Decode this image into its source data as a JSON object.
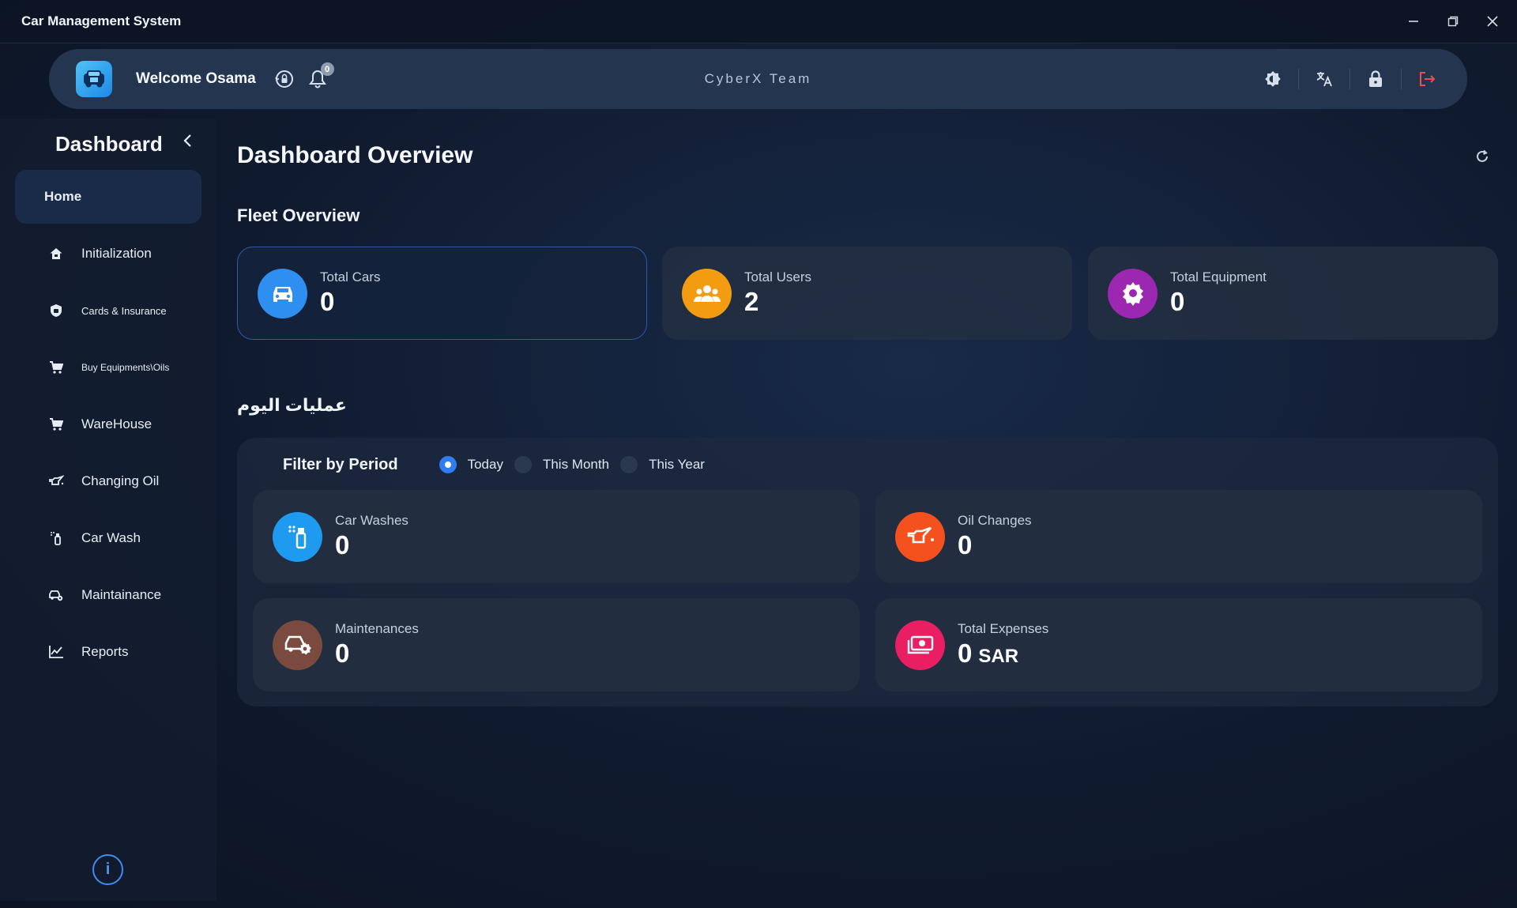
{
  "window": {
    "title": "Car Management System",
    "controls": [
      "minimize",
      "restore",
      "close"
    ]
  },
  "header": {
    "welcome": "Welcome Osama",
    "notification_count": "0",
    "team": "CyberX Team"
  },
  "sidebar": {
    "title": "Dashboard",
    "items": [
      {
        "label": "Home",
        "icon": "none",
        "active": true
      },
      {
        "label": "Initialization",
        "icon": "home-icon"
      },
      {
        "label": "Cards & Insurance",
        "icon": "shield-icon"
      },
      {
        "label": "Buy Equipments\\Oils",
        "icon": "cart-icon"
      },
      {
        "label": "WareHouse",
        "icon": "cart-icon"
      },
      {
        "label": "Changing Oil",
        "icon": "oil-can-icon"
      },
      {
        "label": "Car Wash",
        "icon": "spray-bottle-icon"
      },
      {
        "label": "Maintainance",
        "icon": "car-wrench-icon"
      },
      {
        "label": "Reports",
        "icon": "chart-line-icon"
      }
    ],
    "info": "i"
  },
  "main": {
    "title": "Dashboard Overview",
    "fleet": {
      "title": "Fleet Overview",
      "cards": [
        {
          "label": "Total Cars",
          "value": "0",
          "icon": "car-icon",
          "color": "#2f8ff0"
        },
        {
          "label": "Total Users",
          "value": "2",
          "icon": "users-icon",
          "color": "#f39c12"
        },
        {
          "label": "Total Equipment",
          "value": "0",
          "icon": "gear-icon",
          "color": "#9c27b0"
        }
      ]
    },
    "ops": {
      "title": "عمليات اليوم",
      "filter_label": "Filter by Period",
      "periods": [
        "Today",
        "This Month",
        "This Year"
      ],
      "selected_period": "Today",
      "cards": [
        {
          "label": "Car Washes",
          "value": "0",
          "icon": "spray-bottle-icon",
          "color": "#1e9af0"
        },
        {
          "label": "Oil Changes",
          "value": "0",
          "icon": "oil-can-icon",
          "color": "#f4511e"
        },
        {
          "label": "Maintenances",
          "value": "0",
          "icon": "car-wrench-icon",
          "color": "#7a4a3e"
        },
        {
          "label": "Total Expenses",
          "value": "0",
          "unit": "SAR",
          "icon": "money-icon",
          "color": "#e91e63"
        }
      ]
    }
  }
}
